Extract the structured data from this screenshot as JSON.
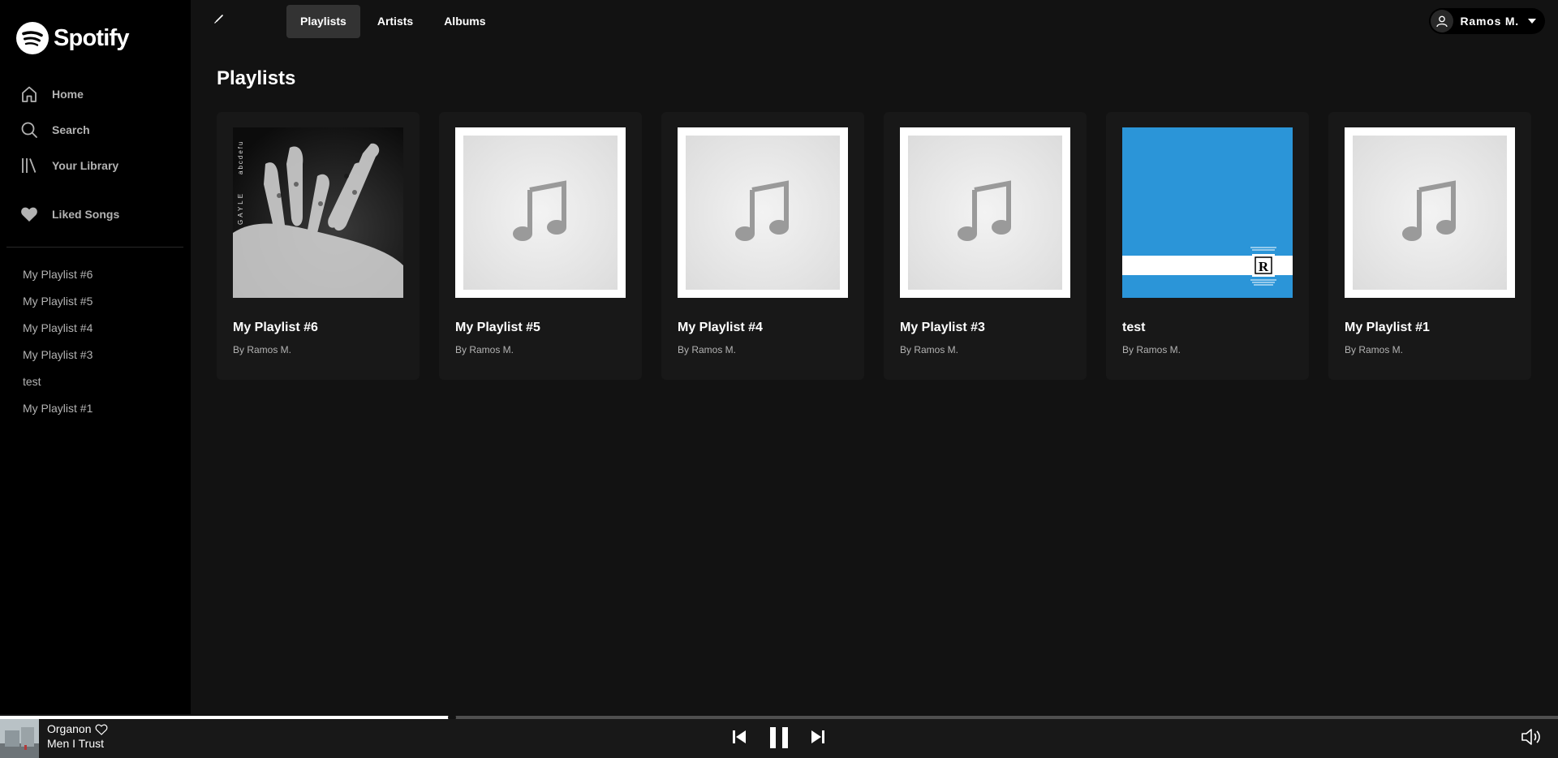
{
  "app": {
    "name": "Spotify"
  },
  "sidebar": {
    "nav": [
      {
        "label": "Home",
        "icon": "home-icon"
      },
      {
        "label": "Search",
        "icon": "search-icon"
      },
      {
        "label": "Your Library",
        "icon": "library-icon"
      }
    ],
    "liked": {
      "label": "Liked Songs",
      "icon": "heart-icon"
    },
    "playlists": [
      "My Playlist #6",
      "My Playlist #5",
      "My Playlist #4",
      "My Playlist #3",
      "test",
      "My Playlist #1"
    ]
  },
  "topbar": {
    "tabs": [
      {
        "label": "Playlists",
        "active": true
      },
      {
        "label": "Artists",
        "active": false
      },
      {
        "label": "Albums",
        "active": false
      }
    ],
    "user": {
      "name": "Ramos M."
    }
  },
  "main": {
    "title": "Playlists",
    "cards": [
      {
        "title": "My Playlist #6",
        "subtitle": "By Ramos M.",
        "cover": "xray-hand-album-art"
      },
      {
        "title": "My Playlist #5",
        "subtitle": "By Ramos M.",
        "cover": "music-note-placeholder"
      },
      {
        "title": "My Playlist #4",
        "subtitle": "By Ramos M.",
        "cover": "music-note-placeholder"
      },
      {
        "title": "My Playlist #3",
        "subtitle": "By Ramos M.",
        "cover": "music-note-placeholder"
      },
      {
        "title": "test",
        "subtitle": "By Ramos M.",
        "cover": "blue-r-album-art"
      },
      {
        "title": "My Playlist #1",
        "subtitle": "By Ramos M.",
        "cover": "music-note-placeholder"
      }
    ],
    "album_art_text": {
      "gayle_artist": "GAYLE",
      "gayle_album": "abcdefu",
      "r_letter": "R"
    }
  },
  "player": {
    "track": "Organon",
    "artist": "Men I Trust",
    "progress_percent": 29,
    "state": "playing",
    "icons": [
      "heart-outline-icon",
      "previous-icon",
      "pause-icon",
      "next-icon",
      "volume-icon"
    ]
  },
  "colors": {
    "background": "#121212",
    "sidebar": "#000000",
    "card": "#181818",
    "accent": "#1DB954",
    "cover_blue": "#2b95d8"
  }
}
